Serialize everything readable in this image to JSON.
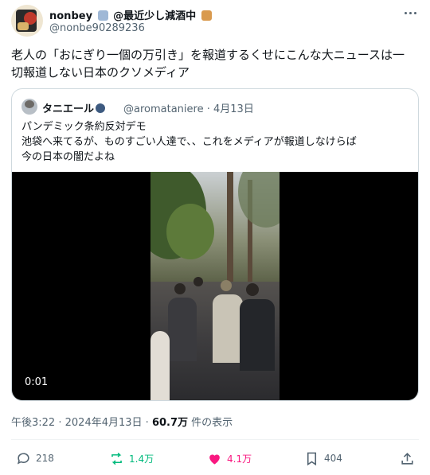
{
  "author": {
    "name": "nonbey",
    "name_suffix": "@最近少し減酒中",
    "handle": "@nonbe90289236"
  },
  "tweet": {
    "text_line1": "老人の「おにぎり一個の万引き」を報道するくせにこんな大ニュースは一",
    "text_line2": "切報道しない日本のクソメディア"
  },
  "quote": {
    "name": "タニエール",
    "handle": "@aromataniere",
    "separator": "·",
    "date": "4月13日",
    "lines": [
      "パンデミック条約反対デモ",
      "池袋へ来てるが、ものすごい人達で、、これをメディアが報道しなけらば",
      "今の日本の闇だよね"
    ],
    "video_time": "0:01"
  },
  "meta": {
    "time": "午後3:22",
    "dot": "·",
    "date": "2024年4月13日",
    "dot2": "·",
    "views": "60.7万",
    "views_suffix": "件の表示"
  },
  "actions": {
    "replies": "218",
    "reposts": "1.4万",
    "likes": "4.1万",
    "bookmarks": "404"
  },
  "colors": {
    "repost": "#00ba7c",
    "like": "#f91880",
    "muted": "#536471"
  },
  "icons": [
    "more-icon",
    "reply-icon",
    "repost-icon",
    "like-icon",
    "bookmark-icon",
    "share-icon"
  ]
}
